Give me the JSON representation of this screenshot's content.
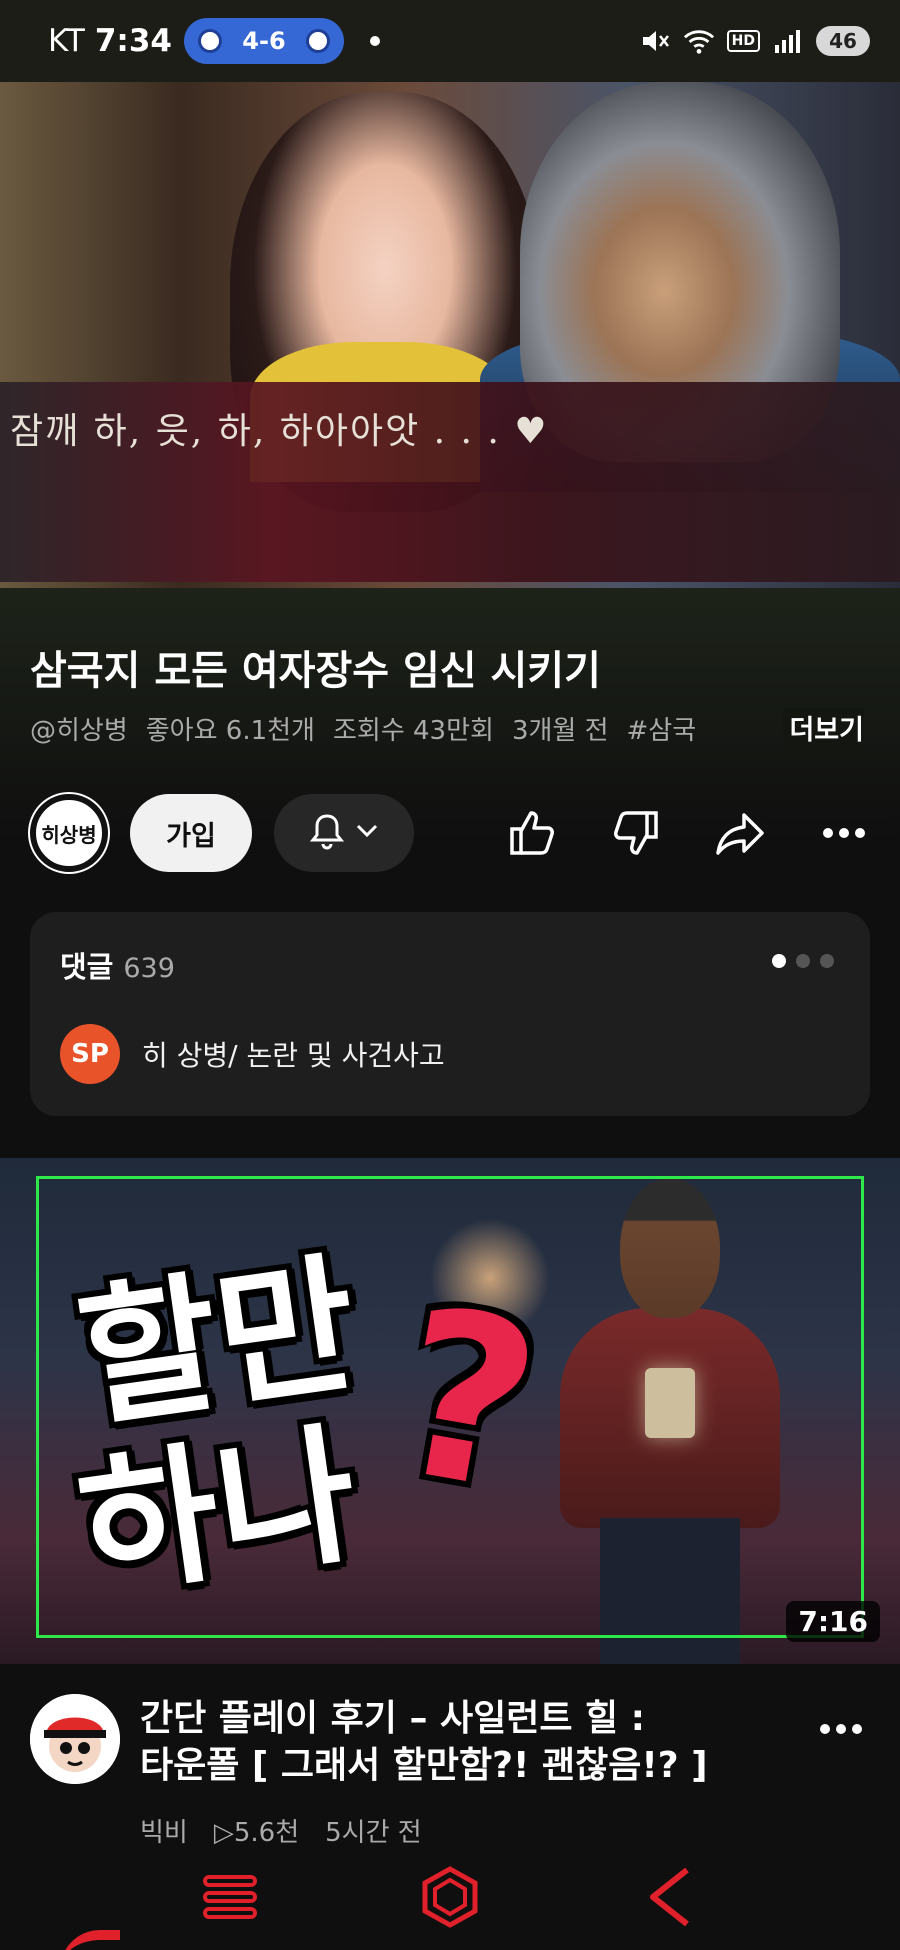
{
  "status_bar": {
    "carrier": "KT",
    "time": "7:34",
    "score": "4-6",
    "battery": "46",
    "hd_label": "HD",
    "network_label": "5"
  },
  "player": {
    "subtitle": "잠깨    하, 읏, 하, 하아아앗 . . . ♥"
  },
  "video": {
    "title": "삼국지 모든 여자장수 임신 시키기",
    "channel_handle": "@히상병",
    "likes": "좋아요 6.1천개",
    "views": "조회수 43만회",
    "age": "3개월 전",
    "hashtag": "#삼국",
    "more_label": "더보기"
  },
  "channel": {
    "avatar_text": "히상병",
    "join_label": "가입"
  },
  "comments": {
    "label": "댓글",
    "count": "639",
    "avatar_initials": "SP",
    "preview_text": "히 상병/ 논란 및 사건사고"
  },
  "next_video": {
    "thumb_line1": "할만",
    "thumb_line2": "하나",
    "thumb_mark": "?",
    "duration": "7:16",
    "title_line1": "간단 플레이 후기 – 사일런트 힐 :",
    "title_line2": "타운폴 [ 그래서 할만함?! 괜찮음!? ]",
    "uploader": "빅비",
    "views": "▷5.6천",
    "age": "5시간 전"
  },
  "colors": {
    "background": "#0f0f0f",
    "accent_red": "#e0202a",
    "score_pill": "#3568d4",
    "frame_green": "#2ee84a"
  },
  "icons": {
    "like": "thumbs-up-icon",
    "dislike": "thumbs-down-icon",
    "share": "share-icon",
    "more": "more-horizontal-icon",
    "bell": "bell-icon",
    "nav_menu": "menu-icon",
    "nav_home": "hexagon-home-icon",
    "nav_back": "back-chevron-icon"
  }
}
